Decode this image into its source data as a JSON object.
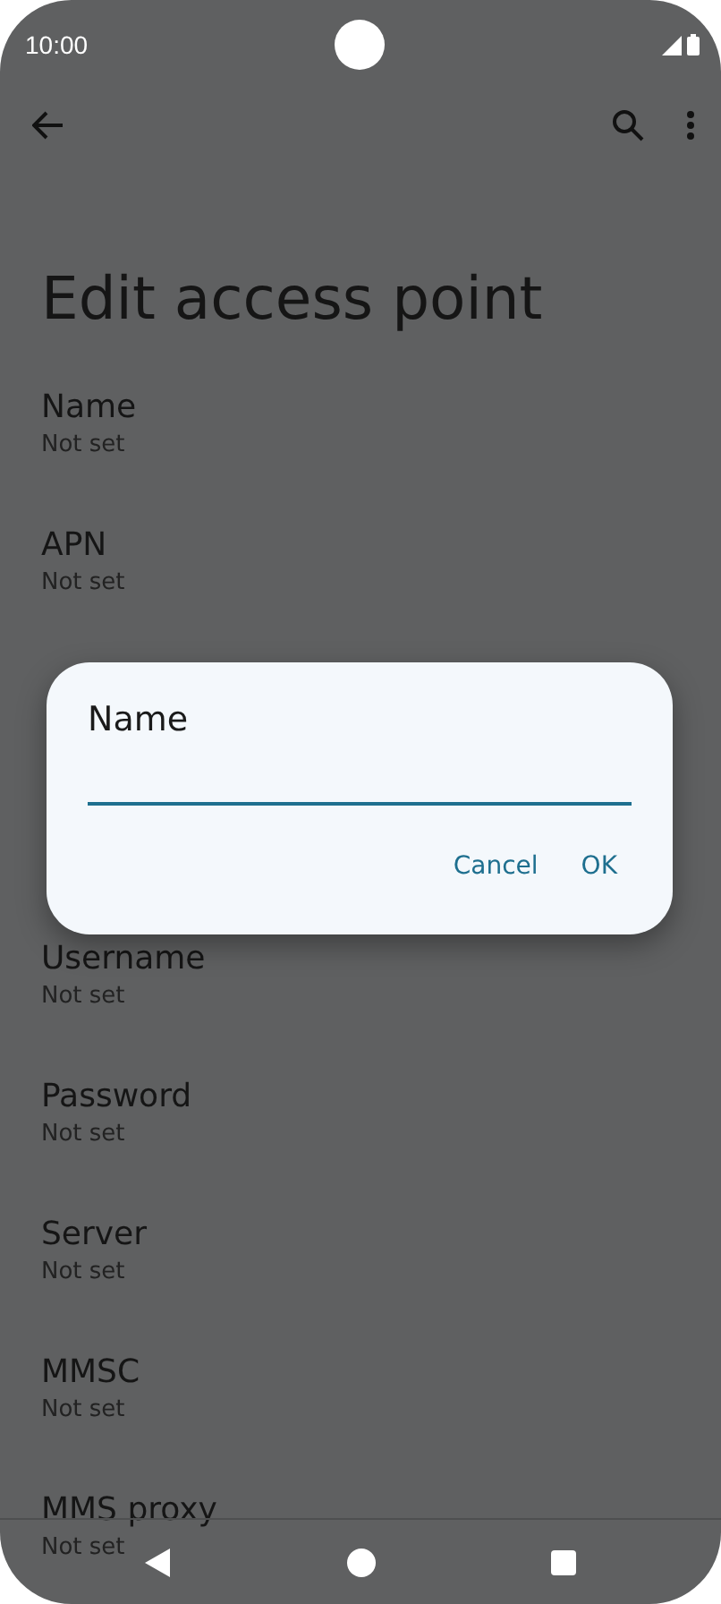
{
  "status_bar": {
    "time": "10:00"
  },
  "title": "Edit access point",
  "settings_top": [
    {
      "label": "Name",
      "value": "Not set"
    },
    {
      "label": "APN",
      "value": "Not set"
    }
  ],
  "settings_bottom": [
    {
      "label": "Username",
      "value": "Not set"
    },
    {
      "label": "Password",
      "value": "Not set"
    },
    {
      "label": "Server",
      "value": "Not set"
    },
    {
      "label": "MMSC",
      "value": "Not set"
    },
    {
      "label": "MMS proxy",
      "value": "Not set"
    }
  ],
  "dialog": {
    "title": "Name",
    "buttons": [
      "Cancel",
      "OK"
    ]
  }
}
